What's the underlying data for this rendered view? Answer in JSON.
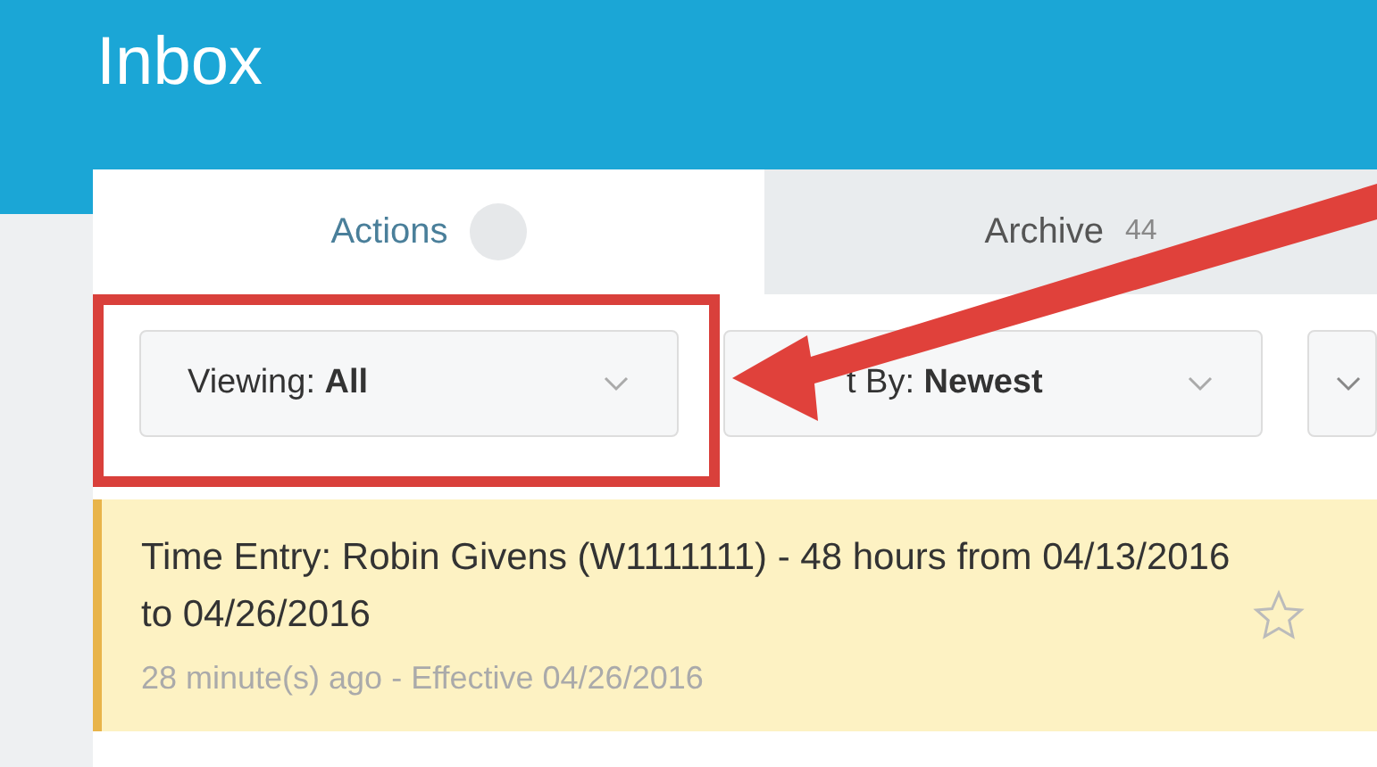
{
  "header": {
    "title": "Inbox"
  },
  "tabs": [
    {
      "label": "Actions",
      "selected": true
    },
    {
      "label": "Archive",
      "count": "44",
      "selected": false
    }
  ],
  "filters": [
    {
      "label": "Viewing:",
      "value": "All",
      "highlighted": true
    },
    {
      "label": "t By:",
      "value": "Newest",
      "highlighted": false
    }
  ],
  "items": [
    {
      "title": "Time Entry: Robin Givens (W1111111) - 48 hours from 04/13/2016 to 04/26/2016",
      "meta": "28 minute(s) ago - Effective 04/26/2016",
      "starred": false
    }
  ]
}
